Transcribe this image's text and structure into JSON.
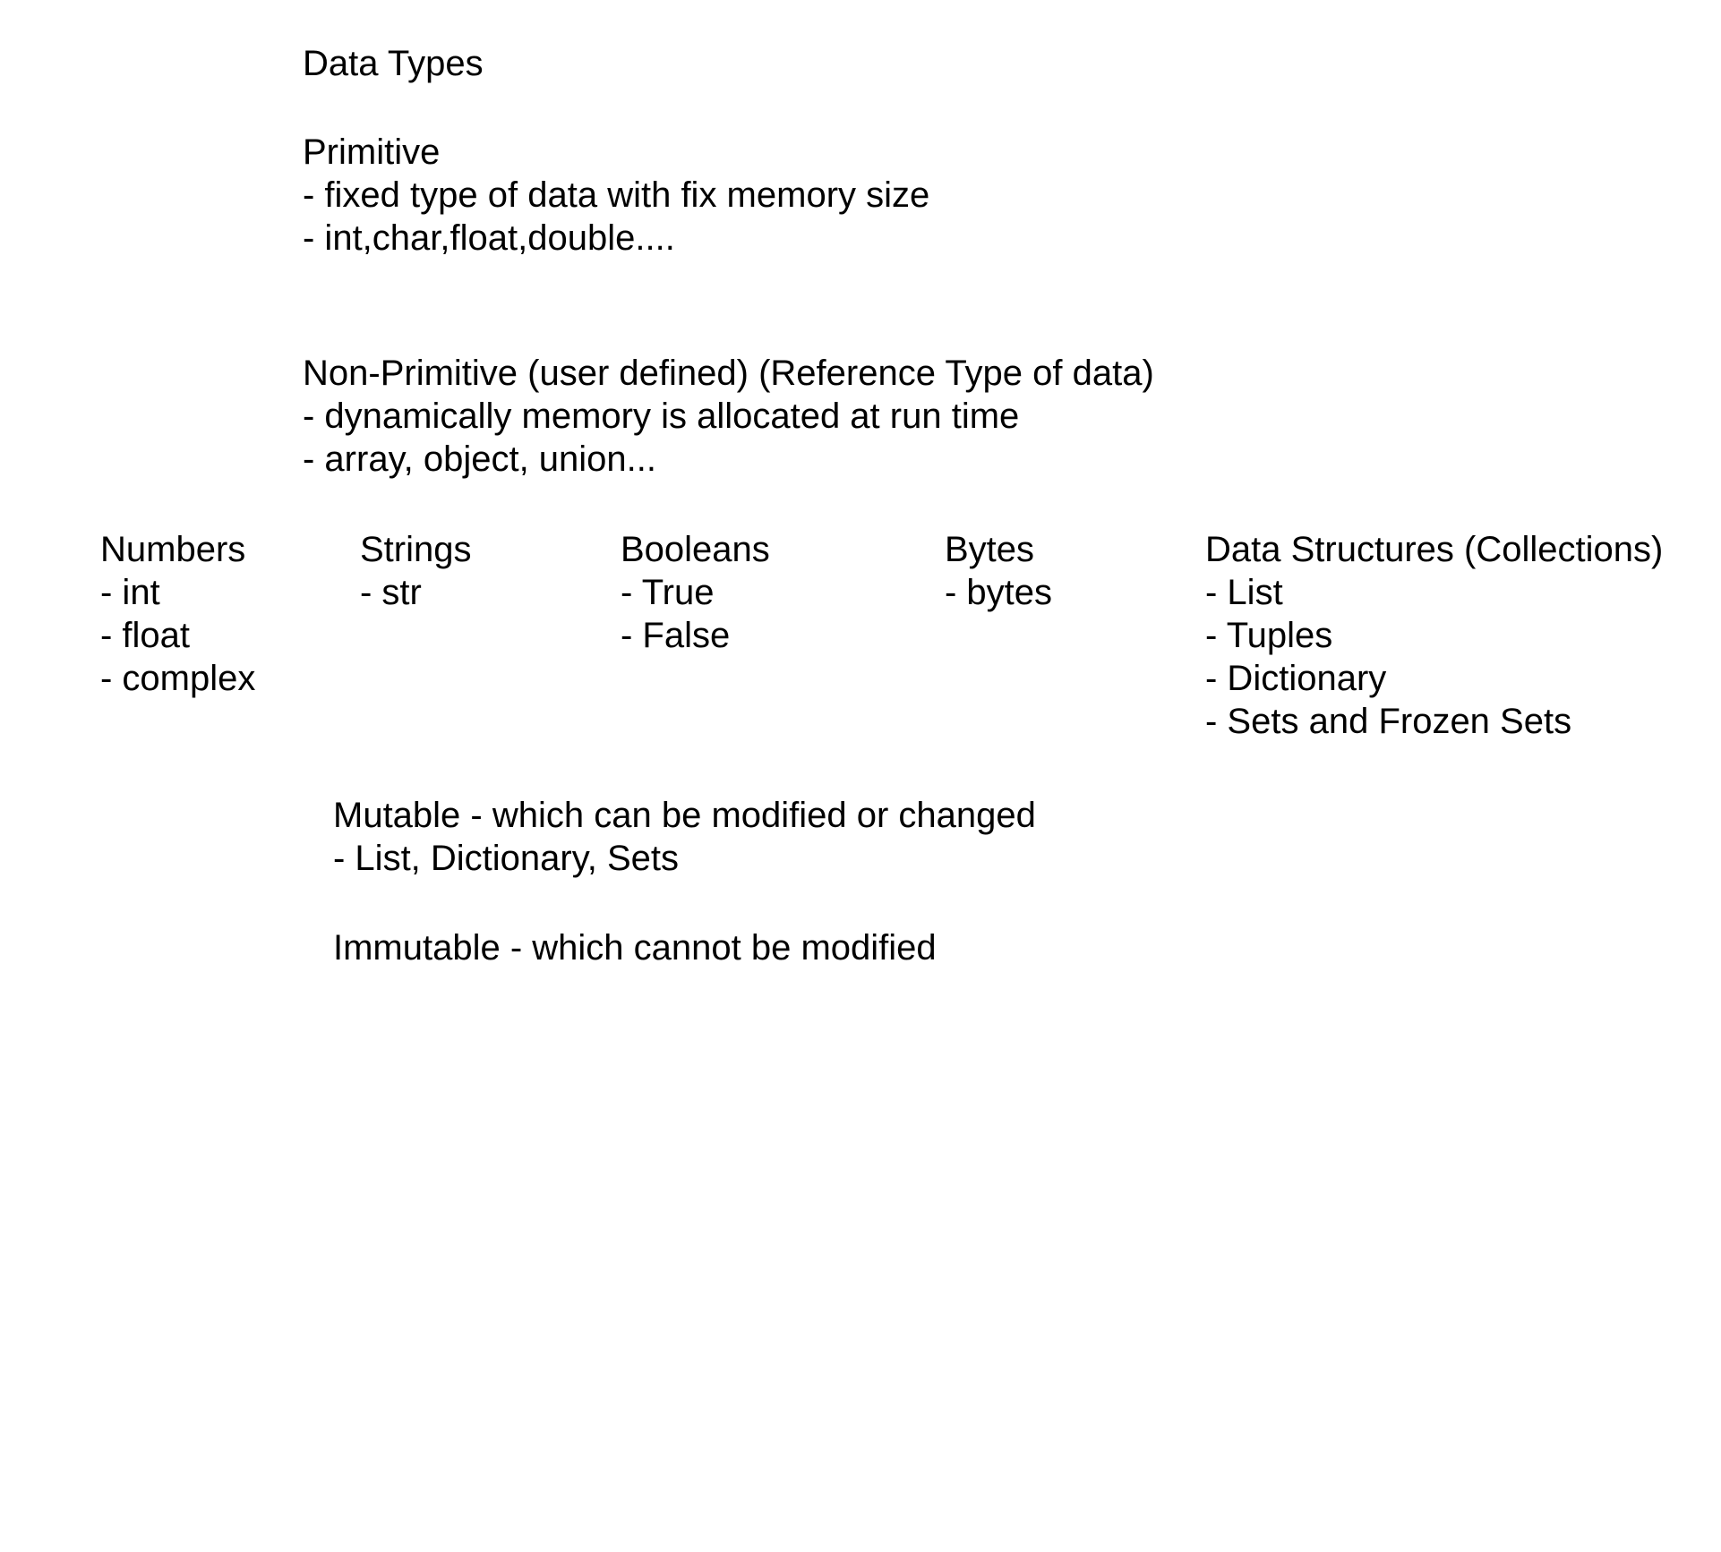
{
  "title": "Data Types",
  "primitive": {
    "heading": "Primitive",
    "points": [
      "- fixed type of data with fix memory size",
      "- int,char,float,double...."
    ]
  },
  "non_primitive": {
    "heading": "Non-Primitive (user defined) (Reference Type of data)",
    "points": [
      "- dynamically memory is allocated at run time",
      "- array, object, union..."
    ]
  },
  "categories": {
    "numbers": {
      "heading": "Numbers",
      "items": [
        "- int",
        "- float",
        "- complex"
      ]
    },
    "strings": {
      "heading": "Strings",
      "items": [
        "- str"
      ]
    },
    "booleans": {
      "heading": "Booleans",
      "items": [
        "- True",
        "- False"
      ]
    },
    "bytes": {
      "heading": "Bytes",
      "items": [
        "- bytes"
      ]
    },
    "data_structures": {
      "heading": "Data Structures (Collections)",
      "items": [
        "- List",
        "- Tuples",
        "- Dictionary",
        "- Sets and Frozen Sets"
      ]
    }
  },
  "mutable": {
    "heading": "Mutable - which can be modified or changed",
    "points": [
      "- List, Dictionary, Sets"
    ]
  },
  "immutable": {
    "heading": "Immutable - which cannot be modified"
  }
}
